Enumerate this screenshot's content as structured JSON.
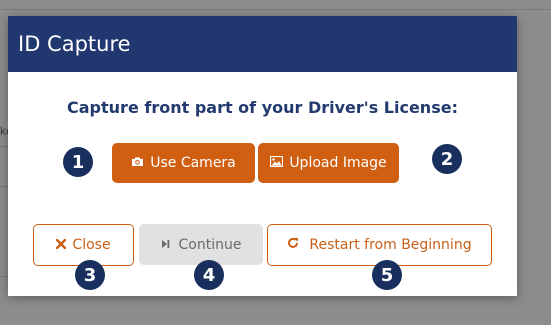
{
  "background": {
    "fragment_text": "ke"
  },
  "modal": {
    "title": "ID Capture",
    "prompt": "Capture front part of your Driver's License:"
  },
  "buttons": {
    "use_camera": "Use Camera",
    "upload_image": "Upload Image",
    "close": "Close",
    "continue": "Continue",
    "restart": "Restart from Beginning"
  },
  "badges": [
    "1",
    "2",
    "3",
    "4",
    "5"
  ],
  "icons": {
    "camera": "camera-icon",
    "image": "image-icon",
    "close": "times-icon",
    "continue": "step-forward-icon",
    "restart": "redo-icon"
  },
  "colors": {
    "header": "#21376f",
    "prompt": "#233a6e",
    "primary": "#d05f12",
    "badge": "#19305e",
    "disabled": "#e1e1e1"
  }
}
